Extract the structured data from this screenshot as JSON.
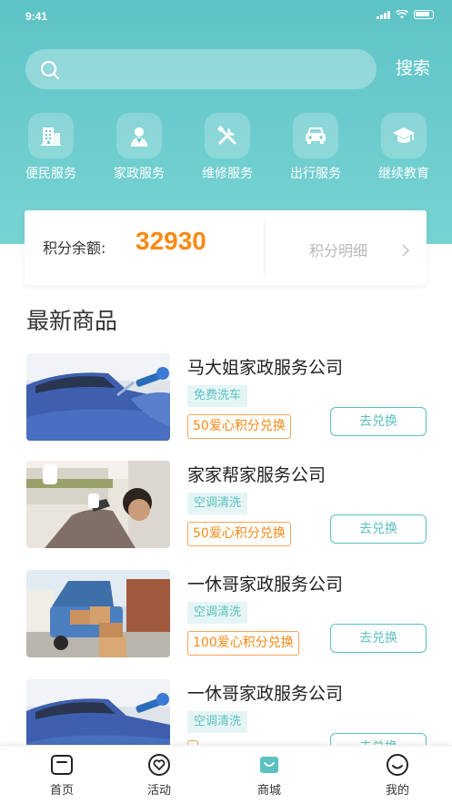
{
  "status_bar": {
    "time": "9:41"
  },
  "search": {
    "placeholder": "",
    "button_label": "搜索"
  },
  "categories": [
    {
      "label": "便民服务",
      "icon": "building-icon"
    },
    {
      "label": "家政服务",
      "icon": "housekeeper-icon"
    },
    {
      "label": "维修服务",
      "icon": "tools-icon"
    },
    {
      "label": "出行服务",
      "icon": "car-icon"
    },
    {
      "label": "继续教育",
      "icon": "graduation-cap-icon"
    }
  ],
  "points": {
    "label": "积分余额:",
    "value": "32930",
    "detail_label": "积分明细"
  },
  "section": {
    "title": "最新商品"
  },
  "products": [
    {
      "name": "马大姐家政服务公司",
      "tag": "免费洗车",
      "points_text": "50爱心积分兑换",
      "button": "去兑换"
    },
    {
      "name": "家家帮家服务公司",
      "tag": "空调清洗",
      "points_text": "50爱心积分兑换",
      "button": "去兑换"
    },
    {
      "name": "一休哥家政服务公司",
      "tag": "空调清洗",
      "points_text": "100爱心积分兑换",
      "button": "去兑换"
    },
    {
      "name": "一休哥家政服务公司",
      "tag": "空调清洗",
      "points_text": "",
      "button": "去兑换"
    }
  ],
  "tabbar": [
    {
      "label": "首页",
      "icon": "home-icon"
    },
    {
      "label": "活动",
      "icon": "heart-icon"
    },
    {
      "label": "商城",
      "icon": "shopping-bag-icon"
    },
    {
      "label": "我的",
      "icon": "smile-icon"
    }
  ],
  "colors": {
    "primary": "#5cc1c2",
    "accent": "#f88a16",
    "header_gradient_top": "#5ec3c6",
    "header_gradient_bottom": "#78d3d3"
  }
}
